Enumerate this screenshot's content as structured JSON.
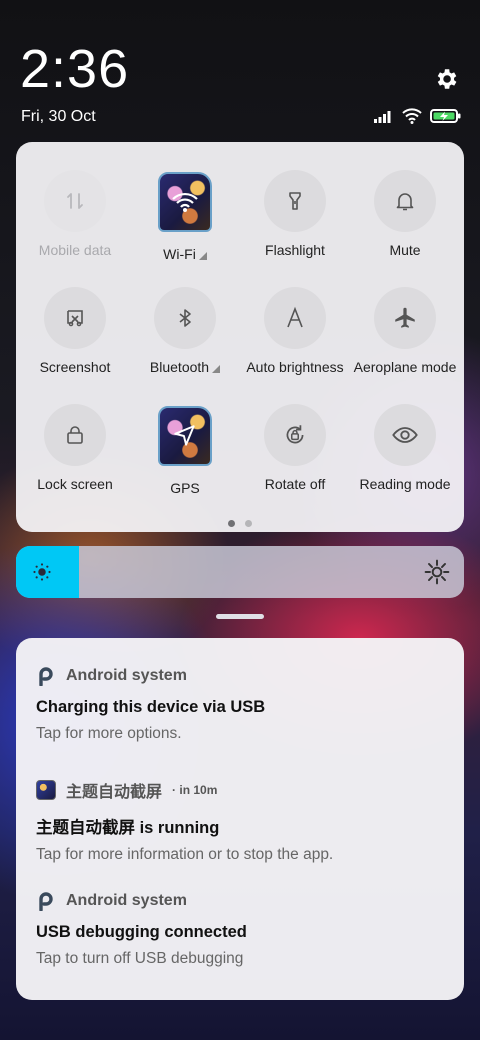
{
  "status": {
    "time": "2:36",
    "date": "Fri, 30 Oct",
    "icons": [
      "signal-icon",
      "wifi-icon",
      "battery-charging-icon"
    ]
  },
  "quick_settings": {
    "tiles": [
      {
        "label": "Mobile data",
        "icon": "mobile-data-icon",
        "state": "disabled"
      },
      {
        "label": "Wi-Fi",
        "icon": "wifi-icon",
        "state": "on",
        "expandable": true
      },
      {
        "label": "Flashlight",
        "icon": "flashlight-icon",
        "state": "off"
      },
      {
        "label": "Mute",
        "icon": "bell-icon",
        "state": "off"
      },
      {
        "label": "Screenshot",
        "icon": "screenshot-icon",
        "state": "off"
      },
      {
        "label": "Bluetooth",
        "icon": "bluetooth-icon",
        "state": "off",
        "expandable": true
      },
      {
        "label": "Auto brightness",
        "icon": "auto-brightness-icon",
        "state": "off"
      },
      {
        "label": "Aeroplane mode",
        "icon": "airplane-icon",
        "state": "off"
      },
      {
        "label": "Lock screen",
        "icon": "lock-icon",
        "state": "off"
      },
      {
        "label": "GPS",
        "icon": "gps-icon",
        "state": "on"
      },
      {
        "label": "Rotate off",
        "icon": "rotate-lock-icon",
        "state": "off"
      },
      {
        "label": "Reading mode",
        "icon": "eye-icon",
        "state": "off"
      }
    ],
    "page_indicator": {
      "current": 1,
      "total": 2
    }
  },
  "brightness": {
    "level": 0.14,
    "accent": "#00c8f5"
  },
  "notifications": [
    {
      "app": "Android system",
      "time": "",
      "title": "Charging this device via USB",
      "text": "Tap for more options."
    },
    {
      "app": "主题自动截屏",
      "time": "in 10m",
      "title": "主题自动截屏 is running",
      "text": "Tap for more information or to stop the app."
    },
    {
      "app": "Android system",
      "time": "",
      "title": "USB debugging connected",
      "text": "Tap to turn off USB debugging"
    }
  ]
}
